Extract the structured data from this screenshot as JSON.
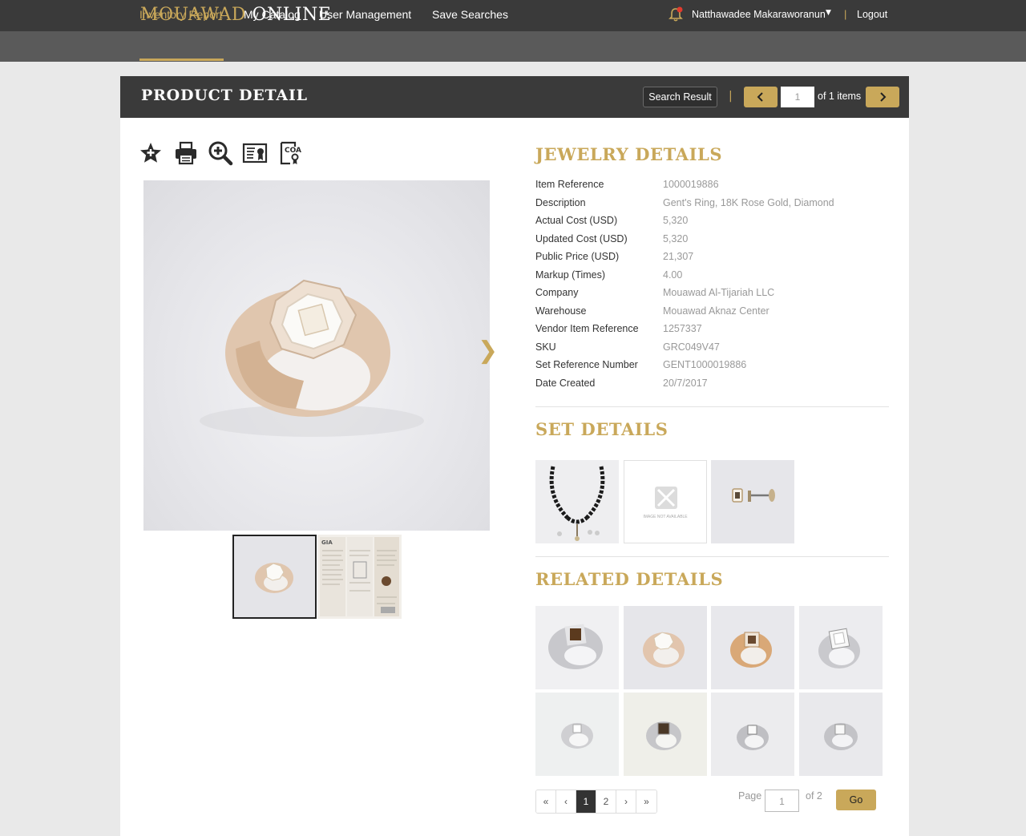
{
  "header": {
    "logo_brand": "MOUAWAD",
    "logo_suffix": "ONLINE",
    "username": "Natthawadee Makaraworanun",
    "logout": "Logout",
    "separator": "|"
  },
  "nav": {
    "items": [
      {
        "label": "Inventory Report",
        "active": true
      },
      {
        "label": "My Catalog"
      },
      {
        "label": "User Management"
      },
      {
        "label": "Save Searches"
      }
    ]
  },
  "panel": {
    "title": "PRODUCT DETAIL",
    "search_result": "Search Result",
    "separator": "|",
    "page_value": "1",
    "of_items": "of 1 items"
  },
  "tools": [
    "favorite-star-icon",
    "print-icon",
    "zoom-in-icon",
    "certificate-icon",
    "coa-icon"
  ],
  "jewelry": {
    "title": "JEWELRY DETAILS",
    "rows": [
      {
        "label": "Item Reference",
        "value": "1000019886"
      },
      {
        "label": "Description",
        "value": "Gent's Ring, 18K Rose Gold, Diamond"
      },
      {
        "label": "Actual Cost (USD)",
        "value": "5,320"
      },
      {
        "label": "Updated Cost (USD)",
        "value": "5,320"
      },
      {
        "label": "Public Price (USD)",
        "value": "21,307"
      },
      {
        "label": "Markup (Times)",
        "value": "4.00"
      },
      {
        "label": "Company",
        "value": "Mouawad Al-Tijariah LLC"
      },
      {
        "label": "Warehouse",
        "value": "Mouawad Aknaz Center"
      },
      {
        "label": "Vendor Item Reference",
        "value": "1257337"
      },
      {
        "label": "SKU",
        "value": "GRC049V47"
      },
      {
        "label": "Set Reference Number",
        "value": "GENT1000019886"
      },
      {
        "label": "Date Created",
        "value": "20/7/2017"
      }
    ]
  },
  "set": {
    "title": "SET DETAILS",
    "image_not_available": "IMAGE NOT AVAILABLE"
  },
  "related": {
    "title": "RELATED DETAILS"
  },
  "pagination": {
    "first": "«",
    "prev": "‹",
    "pages": [
      "1",
      "2"
    ],
    "next": "›",
    "last": "»",
    "page_label": "Page",
    "page_value": "1",
    "of_pages": "of 2",
    "go": "Go"
  },
  "colors": {
    "accent": "#c9a85a",
    "header_dark": "#3a3a3a",
    "nav_gray": "#5a5a5a"
  }
}
